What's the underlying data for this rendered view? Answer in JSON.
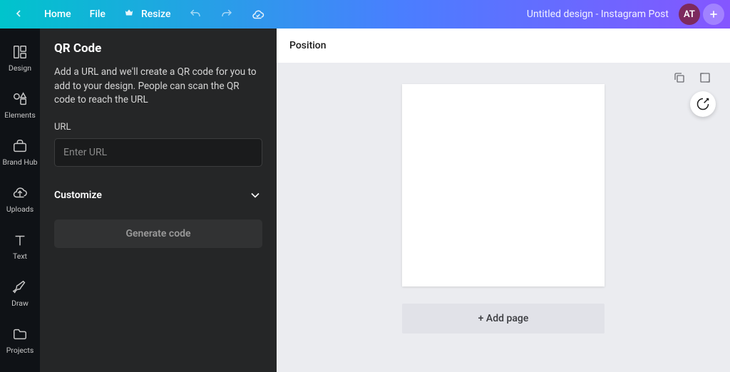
{
  "toolbar": {
    "home_label": "Home",
    "file_label": "File",
    "resize_label": "Resize",
    "doc_title": "Untitled design - Instagram Post",
    "avatar_initials": "AT"
  },
  "rail": {
    "items": [
      {
        "id": "design",
        "label": "Design"
      },
      {
        "id": "elements",
        "label": "Elements"
      },
      {
        "id": "brandhub",
        "label": "Brand Hub"
      },
      {
        "id": "uploads",
        "label": "Uploads"
      },
      {
        "id": "text",
        "label": "Text"
      },
      {
        "id": "draw",
        "label": "Draw"
      },
      {
        "id": "projects",
        "label": "Projects"
      }
    ]
  },
  "panel": {
    "title": "QR Code",
    "description": "Add a URL and we'll create a QR code for you to add to your design. People can scan the QR code to reach the URL",
    "url_label": "URL",
    "url_placeholder": "Enter URL",
    "url_value": "",
    "customize_label": "Customize",
    "generate_label": "Generate code"
  },
  "canvas": {
    "position_label": "Position",
    "add_page_label": "+ Add page"
  }
}
